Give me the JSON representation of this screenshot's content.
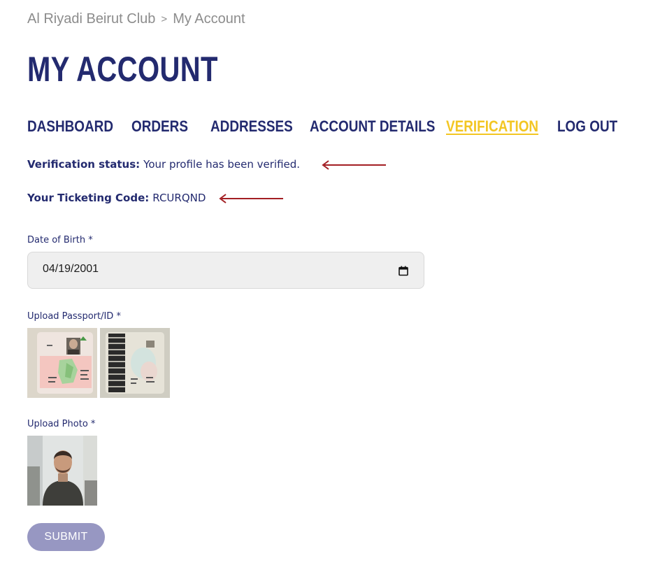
{
  "breadcrumb": {
    "home": "Al Riyadi Beirut Club",
    "separator": ">",
    "current": "My Account"
  },
  "page_title": "MY ACCOUNT",
  "tabs": [
    {
      "label": "DASHBOARD",
      "active": false
    },
    {
      "label": "ORDERS",
      "active": false
    },
    {
      "label": "ADDRESSES",
      "active": false
    },
    {
      "label": "ACCOUNT DETAILS",
      "active": false
    },
    {
      "label": "VERIFICATION",
      "active": true
    },
    {
      "label": "LOG OUT",
      "active": false
    }
  ],
  "verification": {
    "status_label": "Verification status:",
    "status_value": "Your profile has been verified.",
    "code_label": "Your Ticketing Code:",
    "code_value": "RCURQND"
  },
  "form": {
    "dob_label": "Date of Birth *",
    "dob_value": "04/19/2001",
    "passport_label": "Upload Passport/ID *",
    "photo_label": "Upload Photo *",
    "submit_label": "SUBMIT"
  },
  "colors": {
    "primary": "#232a6f",
    "active_tab": "#f3c623",
    "annotation_arrow": "#a31f24",
    "submit_bg": "#9797c2"
  },
  "icons": {
    "calendar": "calendar-icon",
    "arrow": "left-arrow-annotation"
  }
}
